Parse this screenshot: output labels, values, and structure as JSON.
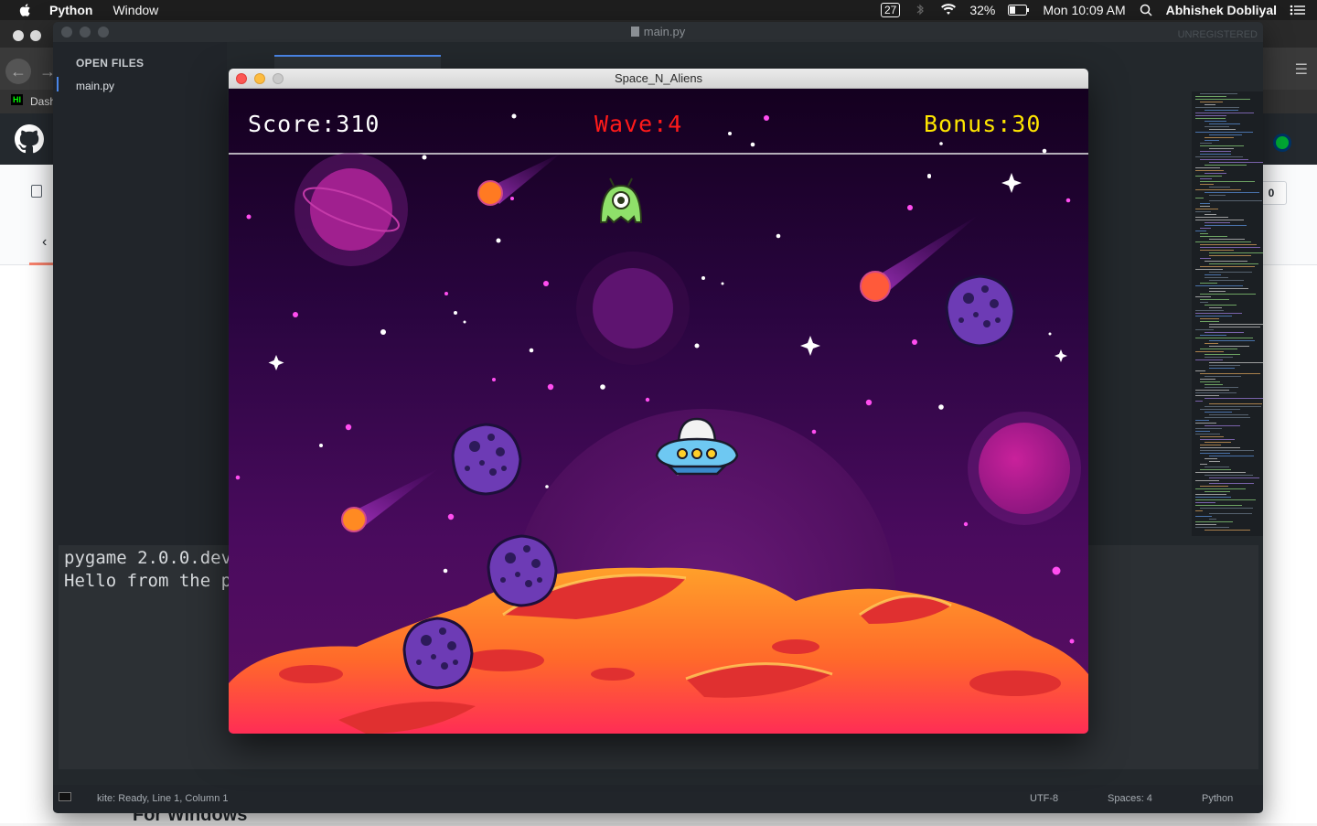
{
  "menubar": {
    "app_name": "Python",
    "menu_window": "Window",
    "badge": "27",
    "battery": "32%",
    "clock": "Mon 10:09 AM",
    "user": "Abhishek Dobliyal"
  },
  "browser": {
    "bookmark_label": "Dash",
    "counter": "0",
    "heading_partial": "For Windows"
  },
  "editor": {
    "title": "main.py",
    "unregistered": "UNREGISTERED",
    "sidebar_header": "OPEN FILES",
    "open_file": "main.py",
    "console_line1": "pygame 2.0.0.dev",
    "console_line2": "Hello from the p",
    "status_left": "kite: Ready, Line 1, Column 1",
    "status_encoding": "UTF-8",
    "status_spaces": "Spaces: 4",
    "status_syntax": "Python"
  },
  "game": {
    "window_title": "Space_N_Aliens",
    "score_label": "Score:310",
    "wave_label": "Wave:4",
    "bonus_label": "Bonus:30",
    "score_color": "#ffffff",
    "wave_color": "#ff1a1a",
    "bonus_color": "#ffe600"
  },
  "icons": [
    "apple-icon",
    "wifi-icon",
    "battery-icon",
    "search-icon",
    "menu-list-icon",
    "bluetooth-icon",
    "github-icon",
    "back-icon",
    "forward-icon"
  ]
}
